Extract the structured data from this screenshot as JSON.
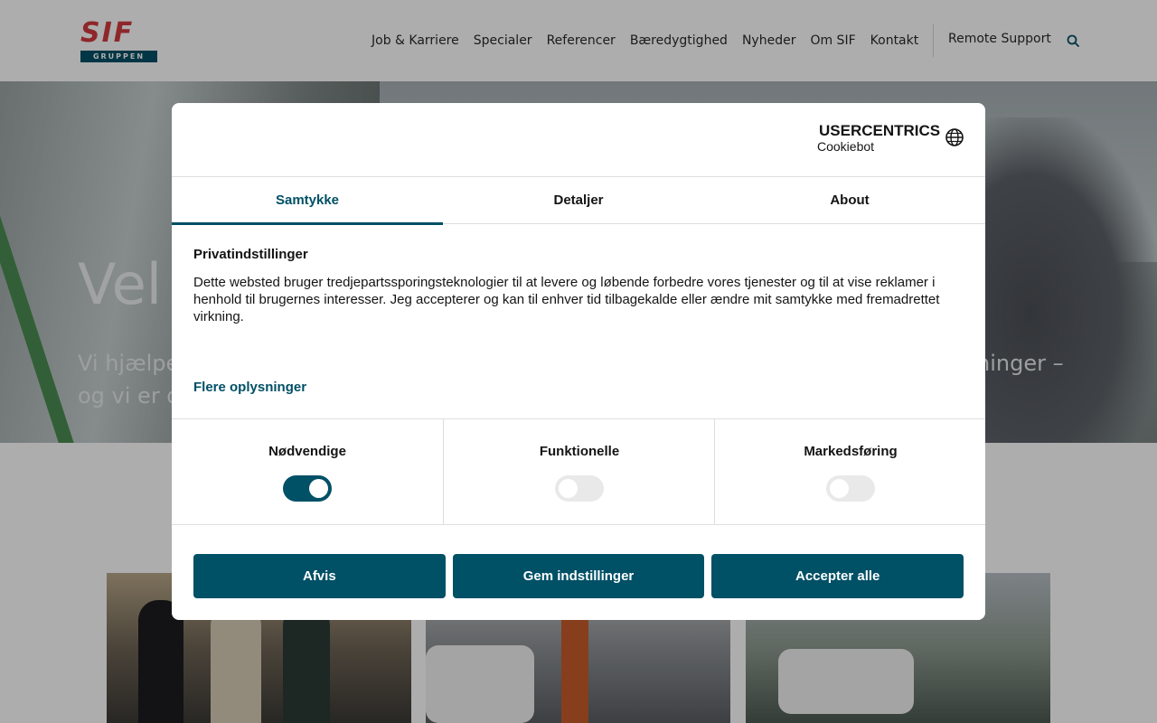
{
  "header": {
    "logo_text": "SIF",
    "logo_sub": "GRUPPEN",
    "nav": [
      "Job & Karriere",
      "Specialer",
      "Referencer",
      "Bæredygtighed",
      "Nyheder",
      "Om SIF",
      "Kontakt"
    ],
    "remote_support": "Remote Support"
  },
  "hero": {
    "title": "Vel",
    "sub_line1": "Vi hjælpe",
    "sub_line2": "og vi er d",
    "sub_right": "ninger –"
  },
  "consent": {
    "brand_top": "USERCENTRICS",
    "brand_bottom": "Cookiebot",
    "tabs": [
      "Samtykke",
      "Detaljer",
      "About"
    ],
    "active_tab": "Samtykke",
    "title": "Privatindstillinger",
    "body": "Dette websted bruger tredjepartssporingsteknologier til at levere og løbende forbedre vores tjenester og til at vise reklamer i henhold til brugernes interesser. Jeg accepterer og kan til enhver tid tilbagekalde eller ændre mit samtykke med fremadrettet virkning.",
    "more_link": "Flere oplysninger",
    "categories": [
      {
        "label": "Nødvendige",
        "enabled": true
      },
      {
        "label": "Funktionelle",
        "enabled": false
      },
      {
        "label": "Markedsføring",
        "enabled": false
      }
    ],
    "buttons": {
      "reject": "Afvis",
      "save": "Gem indstillinger",
      "accept_all": "Accepter alle"
    }
  },
  "colors": {
    "brand_red": "#d23a3f",
    "brand_teal": "#005066"
  },
  "icons": [
    "search-icon",
    "globe-icon",
    "shield-icon"
  ]
}
